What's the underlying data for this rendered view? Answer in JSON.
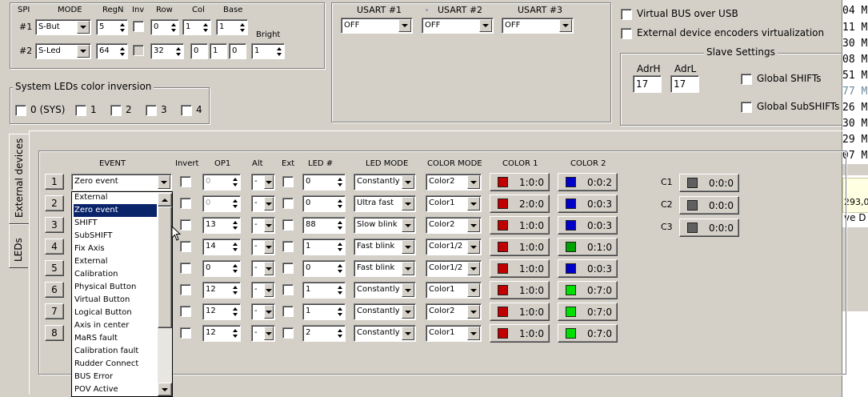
{
  "spi": {
    "title": "SPI",
    "headers": {
      "mode": "MODE",
      "regn": "RegN",
      "inv": "Inv",
      "row": "Row",
      "col": "Col",
      "base": "Base",
      "bright": "Bright"
    },
    "rows": [
      {
        "label": "#1",
        "mode": "S-But",
        "regn": "5",
        "row": "0",
        "col": "1",
        "base": "1"
      },
      {
        "label": "#2",
        "mode": "S-Led",
        "regn": "64",
        "row": "32",
        "f1": "0",
        "f2": "1",
        "f3": "0",
        "bright": "1"
      }
    ]
  },
  "usart": {
    "labels": [
      "USART #1",
      "USART #2",
      "USART #3"
    ],
    "values": [
      "OFF",
      "OFF",
      "OFF"
    ]
  },
  "options": {
    "virtual_bus": "Virtual BUS over USB",
    "encoders_virt": "External device encoders virtualization"
  },
  "slave": {
    "title": "Slave Settings",
    "adrh_label": "AdrH",
    "adrl_label": "AdrL",
    "adrh": "17",
    "adrl": "17",
    "global_shifts": "Global SHIFTs",
    "global_subshifts": "Global SubSHIFTs"
  },
  "sysleds": {
    "title": "System LEDs color inversion",
    "items": [
      "0 (SYS)",
      "1",
      "2",
      "3",
      "4"
    ]
  },
  "tabs": [
    "External devices",
    "LEDs"
  ],
  "table": {
    "headers": {
      "event": "EVENT",
      "invert": "Invert",
      "op1": "OP1",
      "alt": "Alt",
      "ext": "Ext",
      "led": "LED #",
      "ledmode": "LED MODE",
      "colormode": "COLOR MODE",
      "color1": "COLOR 1",
      "color2": "COLOR 2"
    },
    "rows": [
      {
        "num": "1",
        "event": "Zero event",
        "op1": "0",
        "alt": "-",
        "led": "0",
        "ledmode": "Constantly",
        "colormode": "Color2",
        "c1": "1:0:0",
        "c1color": "#c00000",
        "c2": "0:0:2",
        "c2color": "#0000c8"
      },
      {
        "num": "2",
        "op1": "0",
        "alt": "-",
        "led": "0",
        "ledmode": "Ultra fast",
        "colormode": "Color1",
        "c1": "2:0:0",
        "c1color": "#c00000",
        "c2": "0:0:3",
        "c2color": "#0000c8"
      },
      {
        "num": "3",
        "op1": "13",
        "alt": "-",
        "led": "88",
        "ledmode": "Slow blink",
        "colormode": "Color2",
        "c1": "1:0:0",
        "c1color": "#c00000",
        "c2": "0:0:3",
        "c2color": "#0000c8"
      },
      {
        "num": "4",
        "op1": "14",
        "alt": "-",
        "led": "1",
        "ledmode": "Fast blink",
        "colormode": "Color1/2",
        "c1": "1:0:0",
        "c1color": "#c00000",
        "c2": "0:1:0",
        "c2color": "#00a000"
      },
      {
        "num": "5",
        "op1": "0",
        "alt": "-",
        "led": "0",
        "ledmode": "Fast blink",
        "colormode": "Color1/2",
        "c1": "1:0:0",
        "c1color": "#c00000",
        "c2": "0:0:3",
        "c2color": "#0000c8"
      },
      {
        "num": "6",
        "op1": "12",
        "alt": "-",
        "led": "1",
        "ledmode": "Constantly",
        "colormode": "Color1",
        "c1": "1:0:0",
        "c1color": "#c00000",
        "c2": "0:7:0",
        "c2color": "#00e000"
      },
      {
        "num": "7",
        "op1": "12",
        "alt": "-",
        "led": "1",
        "ledmode": "Constantly",
        "colormode": "Color2",
        "c1": "1:0:0",
        "c1color": "#c00000",
        "c2": "0:7:0",
        "c2color": "#00e000"
      },
      {
        "num": "8",
        "op1": "12",
        "alt": "-",
        "led": "2",
        "ledmode": "Constantly",
        "colormode": "Color1",
        "c1": "1:0:0",
        "c1color": "#c00000",
        "c2": "0:7:0",
        "c2color": "#00e000"
      }
    ]
  },
  "event_dropdown": {
    "items": [
      "External",
      "Zero event",
      "SHIFT",
      "SubSHIFT",
      "Fix Axis",
      "External",
      "Calibration",
      "Physical Button",
      "Virtual Button",
      "Logical Button",
      "Axis in center",
      "MaRS fault",
      "Calibration fault",
      "Rudder Connect",
      "BUS Error",
      "POV Active"
    ],
    "selected": "Zero event"
  },
  "c_buttons": [
    {
      "label": "C1",
      "value": "0:0:0",
      "color": "#606060"
    },
    {
      "label": "C2",
      "value": "0:0:0",
      "color": "#606060"
    },
    {
      "label": "C3",
      "value": "0:0:0",
      "color": "#606060"
    }
  ],
  "side": {
    "lines": [
      "04 M",
      "11 M",
      "30 M",
      "08 M",
      "51 M",
      "77 M",
      "26 M",
      "30 M",
      "29 M",
      "07 M"
    ],
    "text1": "293,0",
    "text2": "ve D"
  }
}
